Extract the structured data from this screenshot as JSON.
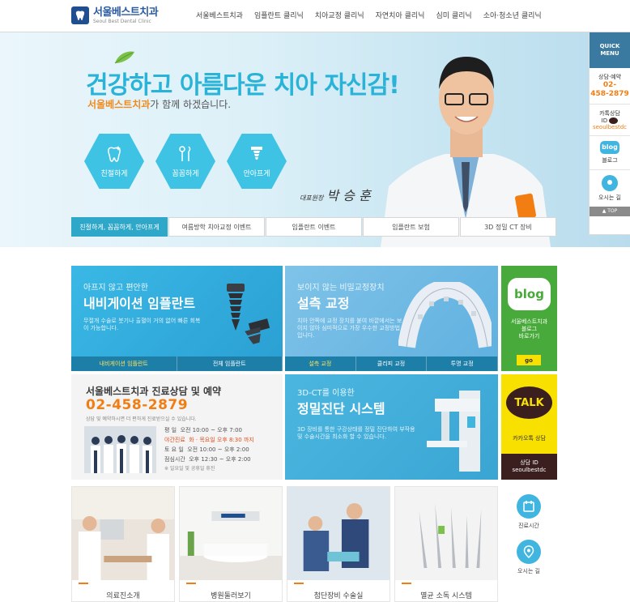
{
  "header": {
    "logo_title": "서울베스트치과",
    "logo_sub": "Seoul Best Dental Clinic",
    "nav": [
      "서울베스트치과",
      "임플란트 클리닉",
      "치아교정 클리닉",
      "자연치아 클리닉",
      "심미 클리닉",
      "소아·청소년 클리닉"
    ]
  },
  "hero": {
    "title": "건강하고 아름다운 치아 자신감!",
    "subtitle_highlight": "서울베스트치과",
    "subtitle_rest": "가 함께 하겠습니다.",
    "hexes": [
      {
        "label": "친절하게",
        "icon": "tooth-sparkle-icon"
      },
      {
        "label": "꼼꼼하게",
        "icon": "dental-tools-icon"
      },
      {
        "label": "안아프게",
        "icon": "implant-icon"
      }
    ],
    "signature_role": "대표원장",
    "signature_name": "박 승 훈",
    "tabs": [
      "친절하게, 꼼꼼하게, 안아프게",
      "여름방학 치아교정 이벤트",
      "임플란트 이벤트",
      "임플란트 보험",
      "3D 정밀 CT 장비"
    ]
  },
  "quick_menu": {
    "title_line1": "QUICK",
    "title_line2": "MENU",
    "consult_label": "상담·예약",
    "phone_line1": "02-",
    "phone_line2": "458-2879",
    "kakao_line1": "카톡상담",
    "kakao_line2": "ID",
    "kakao_id": "seoulbestdc",
    "blog_badge": "blog",
    "blog_label": "블로그",
    "map_label": "오시는 길",
    "top_label": "▲ TOP"
  },
  "boxes": {
    "navi": {
      "small": "아프지 않고 편안한",
      "big": "내비게이션 임플란트",
      "desc": "무절개 수술로 붓기나 출혈이 거의 없어 빠른 회복이 가능합니다.",
      "tabs": [
        "내비게이션 임플란트",
        "전체 임플란트"
      ]
    },
    "brace": {
      "small": "보이지 않는 비밀교정장치",
      "big": "설측 교정",
      "desc": "치아 안쪽에 교정 장치를 붙여 바깥에서는 보이지 않아 심미적으로 가장 우수한 교정방법입니다.",
      "tabs": [
        "설측 교정",
        "클리피 교정",
        "투명 교정"
      ]
    },
    "blog": {
      "logo": "blog",
      "line1": "서울베스트치과",
      "line2": "블로그",
      "line3": "바로가기",
      "go": "go"
    },
    "consult": {
      "title": "서울베스트치과 진료상담 및 예약",
      "phone": "02-458-2879",
      "note": "상담 및 예약하시면 더 편하게 진료받으실 수 있습니다.",
      "hours": [
        {
          "label": "평    일",
          "value": "오전 10:00 ~ 오후 7:00",
          "highlight": false
        },
        {
          "label": "야간진료",
          "value": "화 · 목요일  오후 8:30 까지",
          "highlight": true
        },
        {
          "label": "토 요 일",
          "value": "오전 10:00 ~ 오후 2:00",
          "highlight": false
        },
        {
          "label": "점심시간",
          "value": "오후 12:30 ~ 오후 2:00",
          "highlight": false
        }
      ],
      "closed": "※ 일요일 및 공휴일 휴진"
    },
    "ct": {
      "small": "3D-CT를 이용한",
      "big": "정밀진단 시스템",
      "desc": "3D 장비를 통한 구강상태를 정밀 진단하여 부작용 및 수술시간을 최소화 할 수 있습니다."
    },
    "talk": {
      "logo": "TALK",
      "label": "카카오톡 상담",
      "id_label": "상담 ID",
      "id": "seoulbestdc"
    }
  },
  "thumbs": [
    "의료진소개",
    "병원둘러보기",
    "첨단장비 수술실",
    "멸균 소독 시스템"
  ],
  "side_icons": [
    "진료시간",
    "오시는 길"
  ],
  "colors": {
    "accent": "#2ab3d8",
    "orange": "#f27d12",
    "blog_green": "#48aa3a",
    "kakao_yellow": "#f8e100"
  }
}
